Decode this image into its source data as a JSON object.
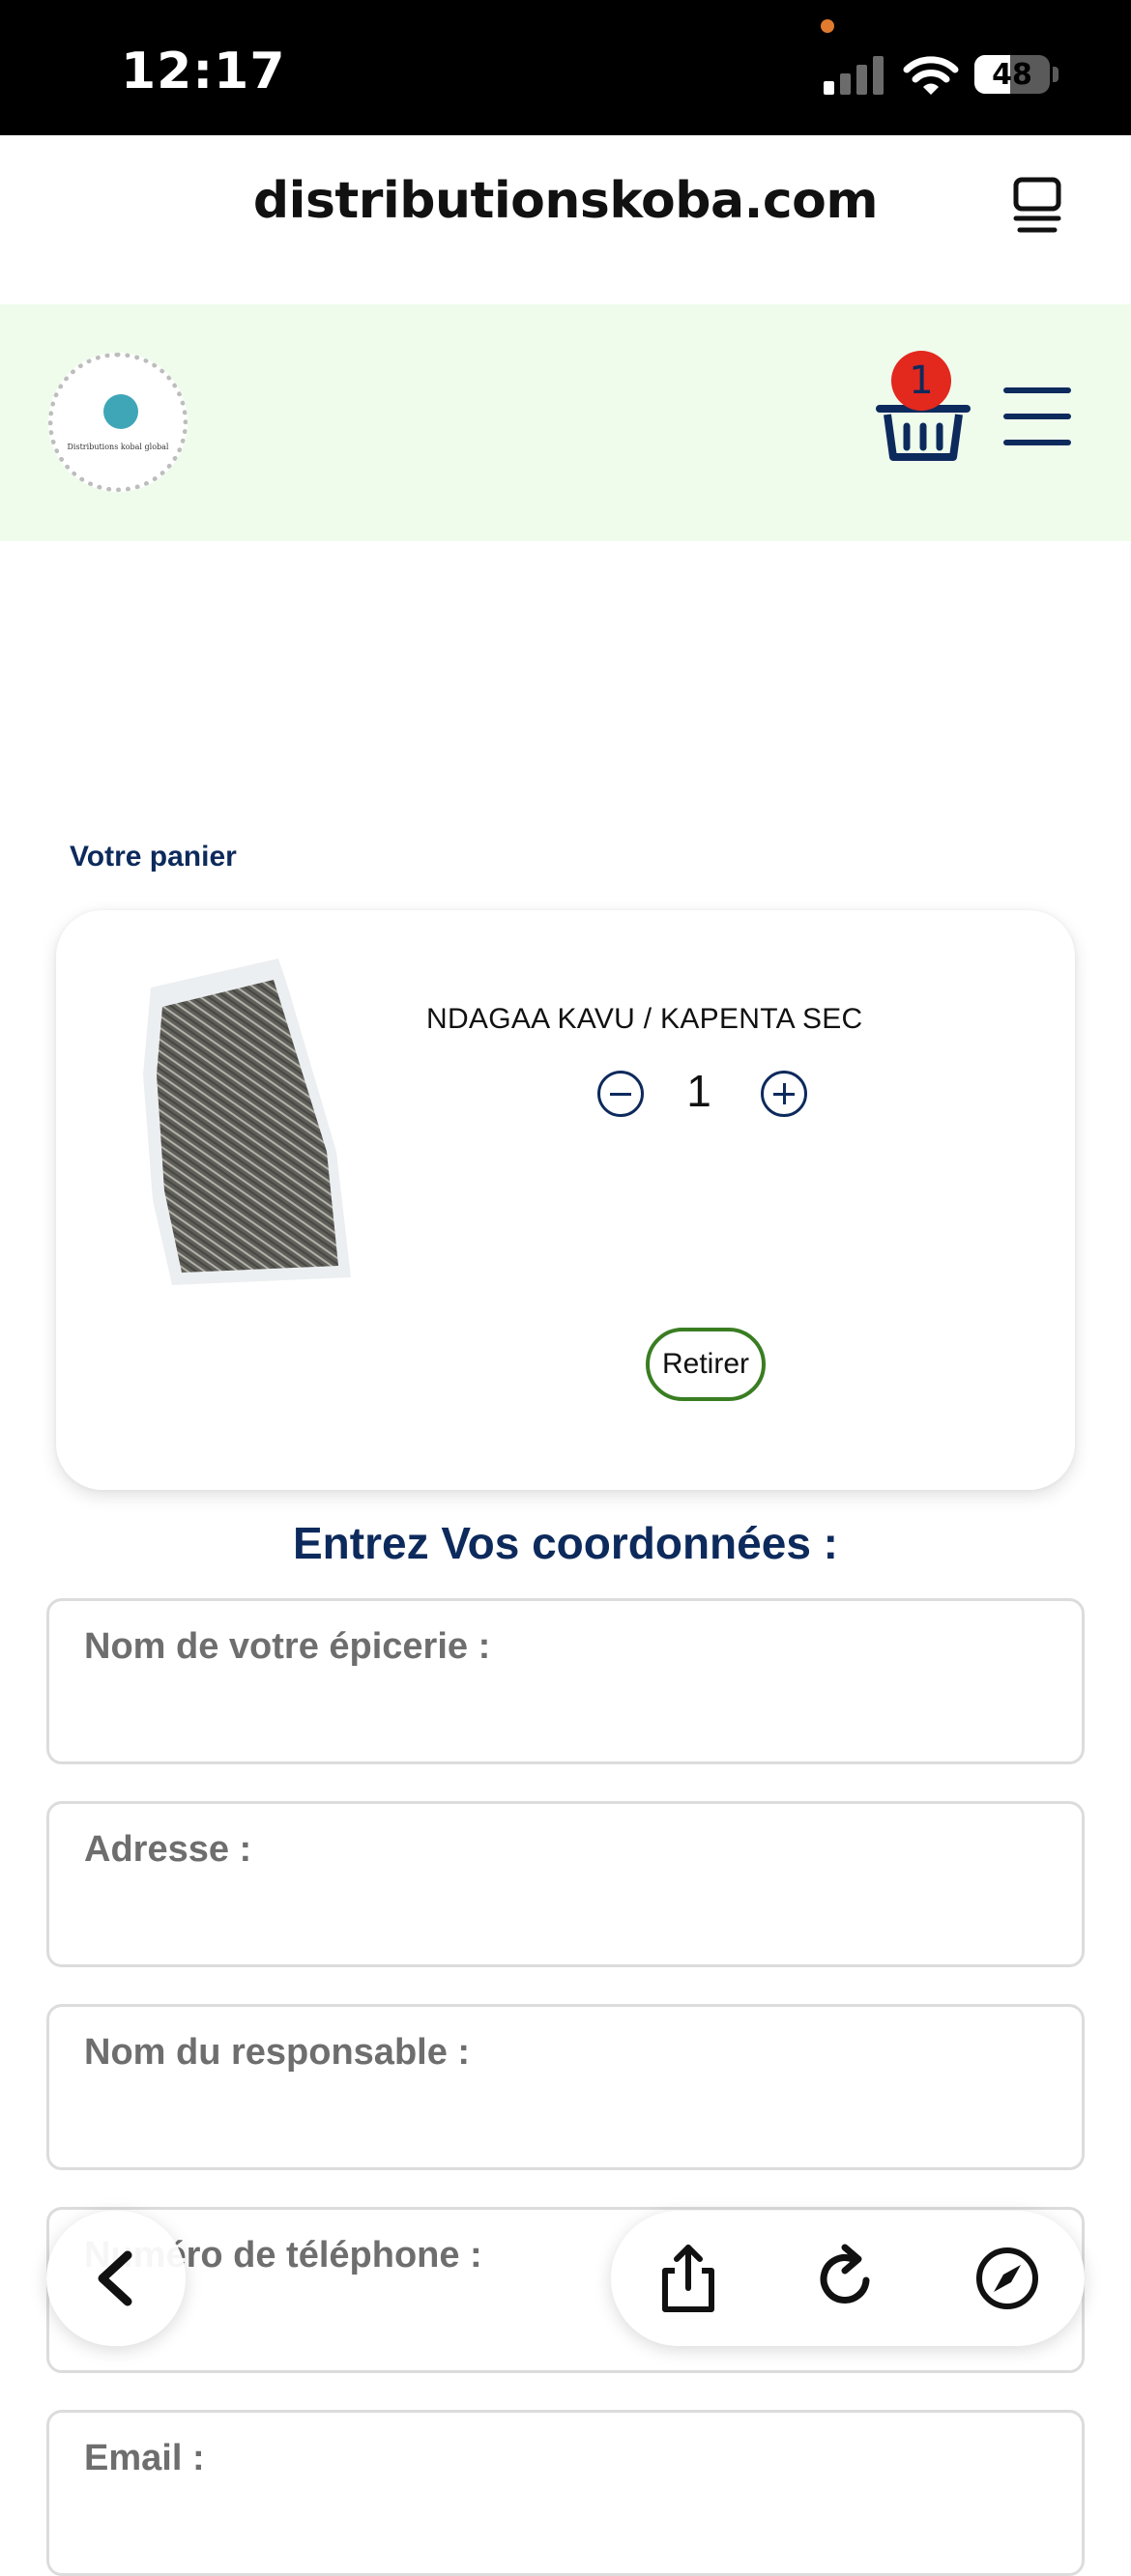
{
  "status_bar": {
    "time": "12:17",
    "battery_percent": "48",
    "battery_level": 0.48,
    "signal_bars_active": 1,
    "signal_bars_total": 4
  },
  "browser": {
    "url": "distributionskoba.com"
  },
  "header": {
    "logo_text": "Distributions kobal global",
    "cart_count": "1"
  },
  "cart": {
    "title": "Votre panier",
    "items": [
      {
        "name": "NDAGAA KAVU / KAPENTA SEC",
        "quantity": "1",
        "remove_label": "Retirer"
      }
    ]
  },
  "form": {
    "title": "Entrez Vos coordonnées :",
    "fields": [
      {
        "label": "Nom de votre épicerie :"
      },
      {
        "label": "Adresse :"
      },
      {
        "label": "Nom du responsable :"
      },
      {
        "label": "Numéro de téléphone :"
      },
      {
        "label": "Email :"
      }
    ]
  },
  "colors": {
    "brand_navy": "#0d2a5c",
    "header_bg": "#effcec",
    "badge_red": "#e3281e",
    "remove_green": "#3a7d22"
  },
  "icons": {
    "back": "chevron-left-icon",
    "share": "share-icon",
    "reload": "reload-icon",
    "compass": "compass-icon",
    "tabs": "tabs-icon",
    "cart": "basket-icon",
    "menu": "hamburger-icon"
  }
}
